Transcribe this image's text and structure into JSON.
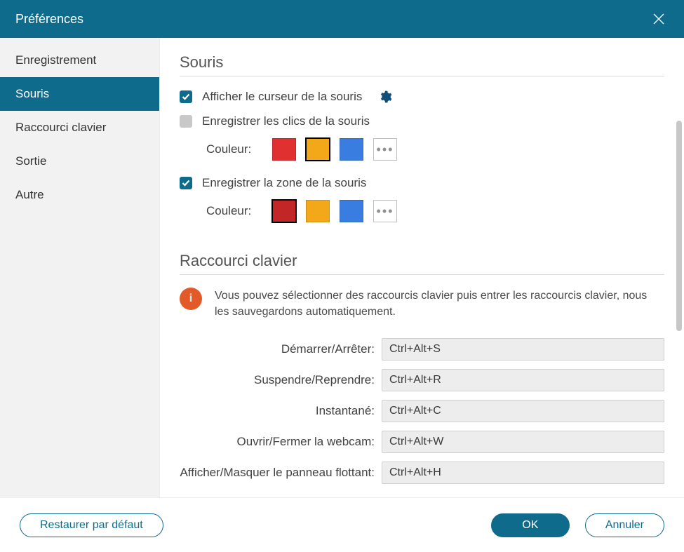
{
  "titlebar": {
    "title": "Préférences"
  },
  "sidebar": {
    "items": [
      {
        "label": "Enregistrement"
      },
      {
        "label": "Souris"
      },
      {
        "label": "Raccourci clavier"
      },
      {
        "label": "Sortie"
      },
      {
        "label": "Autre"
      }
    ]
  },
  "souris": {
    "heading": "Souris",
    "show_cursor_label": "Afficher le curseur de la souris",
    "record_clicks_label": "Enregistrer les clics de la souris",
    "record_area_label": "Enregistrer la zone de la souris",
    "color_label_1": "Couleur:",
    "color_label_2": "Couleur:",
    "click_colors": {
      "red": "#e03030",
      "orange": "#f3a81a",
      "blue": "#3a7de0"
    },
    "area_colors": {
      "red": "#c22626",
      "orange": "#f3a81a",
      "blue": "#3a7de0"
    },
    "more_glyph": "•••"
  },
  "raccourci": {
    "heading": "Raccourci clavier",
    "info_text": "Vous pouvez sélectionner des raccourcis clavier puis entrer les raccourcis clavier, nous les sauvegardons automatiquement.",
    "rows": [
      {
        "label": "Démarrer/Arrêter:",
        "value": "Ctrl+Alt+S"
      },
      {
        "label": "Suspendre/Reprendre:",
        "value": "Ctrl+Alt+R"
      },
      {
        "label": "Instantané:",
        "value": "Ctrl+Alt+C"
      },
      {
        "label": "Ouvrir/Fermer la webcam:",
        "value": "Ctrl+Alt+W"
      },
      {
        "label": "Afficher/Masquer le panneau flottant:",
        "value": "Ctrl+Alt+H"
      }
    ]
  },
  "footer": {
    "restore_label": "Restaurer par défaut",
    "ok_label": "OK",
    "cancel_label": "Annuler"
  }
}
